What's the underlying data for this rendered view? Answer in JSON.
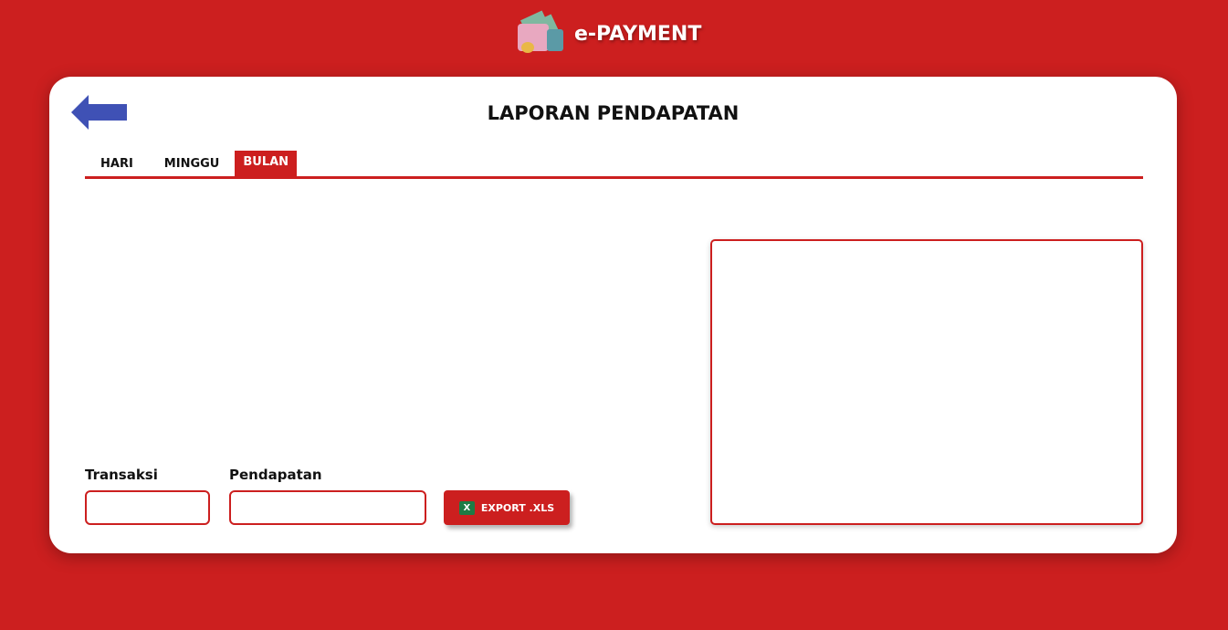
{
  "header": {
    "brand": "e-PAYMENT",
    "logo_icon": "wallet-icon"
  },
  "page": {
    "title": "LAPORAN PENDAPATAN",
    "back_icon": "arrow-left-icon"
  },
  "tabs": [
    {
      "label": "HARI",
      "active": false
    },
    {
      "label": "MINGGU",
      "active": false
    },
    {
      "label": "BULAN",
      "active": true
    }
  ],
  "form": {
    "transaksi_label": "Transaksi",
    "transaksi_value": "",
    "pendapatan_label": "Pendapatan",
    "pendapatan_value": "",
    "export_label": "EXPORT .XLS",
    "export_icon": "excel-icon"
  },
  "colors": {
    "primary": "#cc1f1f",
    "back_arrow": "#3f51b5"
  }
}
